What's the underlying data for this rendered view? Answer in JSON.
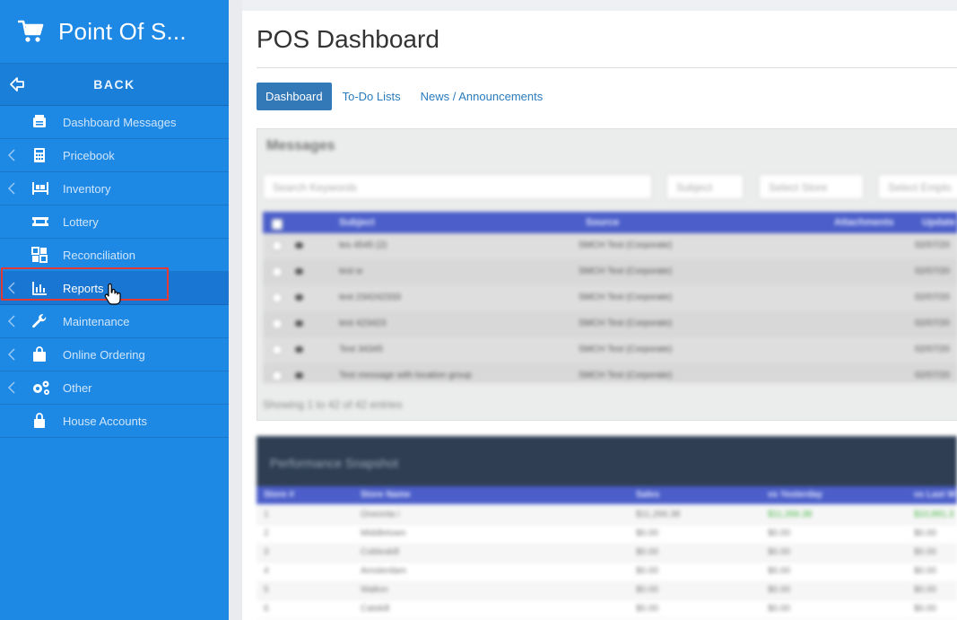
{
  "app": {
    "title": "Point Of S..."
  },
  "sidebar": {
    "back_label": "BACK",
    "items": [
      {
        "label": "Dashboard Messages",
        "icon": "message-icon",
        "has_chevron": false,
        "active": false
      },
      {
        "label": "Pricebook",
        "icon": "calculator-icon",
        "has_chevron": true,
        "active": false
      },
      {
        "label": "Inventory",
        "icon": "pallet-icon",
        "has_chevron": true,
        "active": false
      },
      {
        "label": "Lottery",
        "icon": "ticket-icon",
        "has_chevron": false,
        "active": false
      },
      {
        "label": "Reconciliation",
        "icon": "grid-icon",
        "has_chevron": false,
        "active": false
      },
      {
        "label": "Reports",
        "icon": "bar-chart-icon",
        "has_chevron": true,
        "active": true
      },
      {
        "label": "Maintenance",
        "icon": "wrench-icon",
        "has_chevron": true,
        "active": false
      },
      {
        "label": "Online Ordering",
        "icon": "shopping-bag-icon",
        "has_chevron": true,
        "active": false
      },
      {
        "label": "Other",
        "icon": "gears-icon",
        "has_chevron": true,
        "active": false
      },
      {
        "label": "House Accounts",
        "icon": "lock-bag-icon",
        "has_chevron": false,
        "active": false
      }
    ]
  },
  "main": {
    "page_title": "POS Dashboard",
    "tabs": [
      {
        "label": "Dashboard",
        "active": true
      },
      {
        "label": "To-Do Lists",
        "active": false
      },
      {
        "label": "News / Announcements",
        "active": false
      }
    ],
    "messages": {
      "title": "Messages",
      "search_placeholder": "Search Keywords",
      "subject_filter": "Subject",
      "store_filter": "Select Store",
      "employee_filter": "Select Emplo",
      "columns": [
        "Subject",
        "Source",
        "Attachments",
        "Update"
      ],
      "rows": [
        {
          "subject": "tes 4545 (2)",
          "source": "SMCH Test (Corporate)",
          "updated": "02/07/20"
        },
        {
          "subject": "test w",
          "source": "SMCH Test (Corporate)",
          "updated": "02/07/20"
        },
        {
          "subject": "test 234242333",
          "source": "SMCH Test (Corporate)",
          "updated": "02/07/20"
        },
        {
          "subject": "test 423423",
          "source": "SMCH Test (Corporate)",
          "updated": "02/07/20"
        },
        {
          "subject": "Test 34345",
          "source": "SMCH Test (Corporate)",
          "updated": "02/07/20"
        },
        {
          "subject": "Test message with location group",
          "source": "SMCH Test (Corporate)",
          "updated": "02/07/20"
        }
      ],
      "showing_text": "Showing 1 to 42 of 42 entries"
    },
    "performance": {
      "title": "Performance Snapshot",
      "columns": [
        "Store #",
        "Store Name",
        "Sales",
        "vs Yesterday",
        "vs Last W"
      ],
      "rows": [
        {
          "num": "1",
          "name": "Oneonta i",
          "sales": "$11,266.38",
          "vs_yesterday": "$11,266.38",
          "vs_last": "$10,891.3"
        },
        {
          "num": "2",
          "name": "Middletown",
          "sales": "$0.00",
          "vs_yesterday": "$0.00",
          "vs_last": "$0.00"
        },
        {
          "num": "3",
          "name": "Cobleskill",
          "sales": "$0.00",
          "vs_yesterday": "$0.00",
          "vs_last": "$0.00"
        },
        {
          "num": "4",
          "name": "Amsterdam",
          "sales": "$0.00",
          "vs_yesterday": "$0.00",
          "vs_last": "$0.00"
        },
        {
          "num": "5",
          "name": "Walton",
          "sales": "$0.00",
          "vs_yesterday": "$0.00",
          "vs_last": "$0.00"
        },
        {
          "num": "6",
          "name": "Catskill",
          "sales": "$0.00",
          "vs_yesterday": "$0.00",
          "vs_last": "$0.00"
        }
      ]
    }
  },
  "colors": {
    "sidebar": "#1e88e5",
    "sidebar_active": "#1976d2",
    "tab_active": "#3379b7",
    "table_header": "#4b5ec9",
    "perf_header": "#2f3e53",
    "highlight": "#e53935"
  }
}
